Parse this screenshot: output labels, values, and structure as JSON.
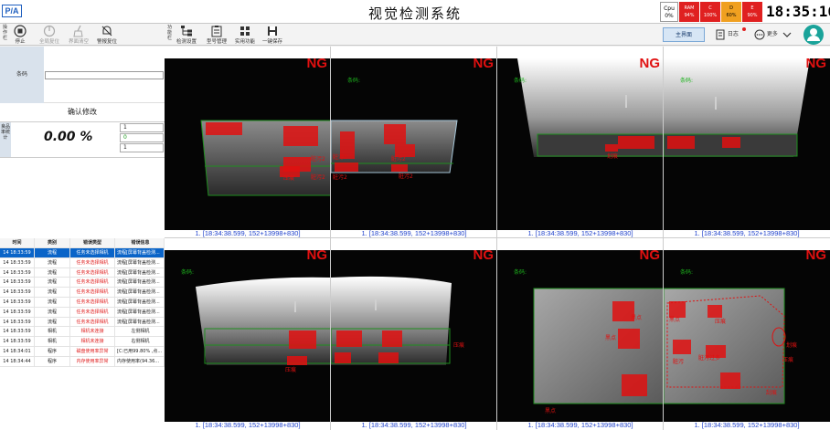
{
  "title": {
    "logo": "P/A",
    "app_name": "视觉检测系统",
    "clock": "18:35:16"
  },
  "status": [
    {
      "label": "Cpu",
      "value": "0%",
      "color": "#ffffff"
    },
    {
      "label": "RAM",
      "value": "94%",
      "color": "#e02020"
    },
    {
      "label": "C",
      "value": "100%",
      "color": "#e02020"
    },
    {
      "label": "D",
      "value": "60%",
      "color": "#f0a020"
    },
    {
      "label": "E",
      "value": "90%",
      "color": "#e02020"
    }
  ],
  "toolbar": {
    "left_group_label": "操作栏",
    "stop": "停止",
    "global_reset": "全局复位",
    "clear_screen": "界面清空",
    "alarm_reset": "警报复位",
    "func_group_label": "功能栏",
    "detect_settings": "检测设置",
    "model_manage": "型号管理",
    "utilities": "实用功能",
    "save_all": "一键保存",
    "main_tab": "主界面",
    "log": "日志",
    "more": "更多"
  },
  "left": {
    "barcode_label": "条码",
    "barcode_value": "",
    "confirm": "确认修改",
    "rate_label": "良品率统计",
    "rate": "0.00 %",
    "counts": [
      "1",
      "0",
      "1"
    ]
  },
  "log": {
    "headers": [
      "时间",
      "类别",
      "错误类型",
      "错误信息"
    ],
    "rows": [
      [
        "14 18:33:59",
        "流程",
        "任务未选择相机",
        "流程[屏幕背盖检测..."
      ],
      [
        "14 18:33:59",
        "流程",
        "任务未选择相机",
        "流程[屏幕背盖检测..."
      ],
      [
        "14 18:33:59",
        "流程",
        "任务未选择相机",
        "流程[屏幕背盖检测..."
      ],
      [
        "14 18:33:59",
        "流程",
        "任务未选择相机",
        "流程[屏幕背盖检测..."
      ],
      [
        "14 18:33:59",
        "流程",
        "任务未选择相机",
        "流程[屏幕背盖检测..."
      ],
      [
        "14 18:33:59",
        "流程",
        "任务未选择相机",
        "流程[屏幕背盖检测..."
      ],
      [
        "14 18:33:59",
        "流程",
        "任务未选择相机",
        "流程[屏幕背盖检测..."
      ],
      [
        "14 18:33:59",
        "流程",
        "任务未选择相机",
        "流程[屏幕背盖检测..."
      ],
      [
        "14 18:33:59",
        "相机",
        "相机未连接",
        "左侧相机"
      ],
      [
        "14 18:33:59",
        "相机",
        "相机未连接",
        "右侧相机"
      ],
      [
        "14 18:34:01",
        "程序",
        "磁盘使用率异常",
        "[C:已用99.80% ,点..."
      ],
      [
        "14 18:34:44",
        "程序",
        "内存使用率异常",
        "内存使用率(94.36..."
      ]
    ]
  },
  "cameras": [
    {
      "result": "NG",
      "barcode": "条码:",
      "caption": "1. [18:34:38.599, 152+13998+830]"
    },
    {
      "result": "NG",
      "barcode": "条码:",
      "caption": "1. [18:34:38.599, 152+13998+830]"
    },
    {
      "result": "NG",
      "barcode": "条码:",
      "caption": "1. [18:34:38.599, 152+13998+830]"
    },
    {
      "result": "NG",
      "barcode": "条码:",
      "caption": "1. [18:34:38.599, 152+13998+830]"
    },
    {
      "result": "NG",
      "barcode": "条码:",
      "caption": "1. [18:34:38.599, 152+13998+830]"
    },
    {
      "result": "NG",
      "barcode": "条码:",
      "caption": "1. [18:34:38.599, 152+13998+830]"
    },
    {
      "result": "NG",
      "barcode": "条码:",
      "caption": "1. [18:34:38.599, 152+13998+830]"
    },
    {
      "result": "NG",
      "barcode": "条码:",
      "caption": "1. [18:34:38.599, 152+13998+830]"
    }
  ],
  "defect_labels": {
    "cam0": [
      "脏污2",
      "脏污2",
      "压痕"
    ],
    "cam1": [
      "脏污2",
      "脏污2",
      "脏污2",
      "脏污2"
    ],
    "cam2": [
      "划痕"
    ],
    "cam4": [
      "压痕"
    ],
    "cam5": [
      "压痕"
    ],
    "cam6": [
      "黑点",
      "黑点",
      "黑点"
    ],
    "cam7": [
      "黑点",
      "压痕",
      "脏污过多",
      "脏污",
      "划痕",
      "压痕",
      "刮痕"
    ]
  }
}
